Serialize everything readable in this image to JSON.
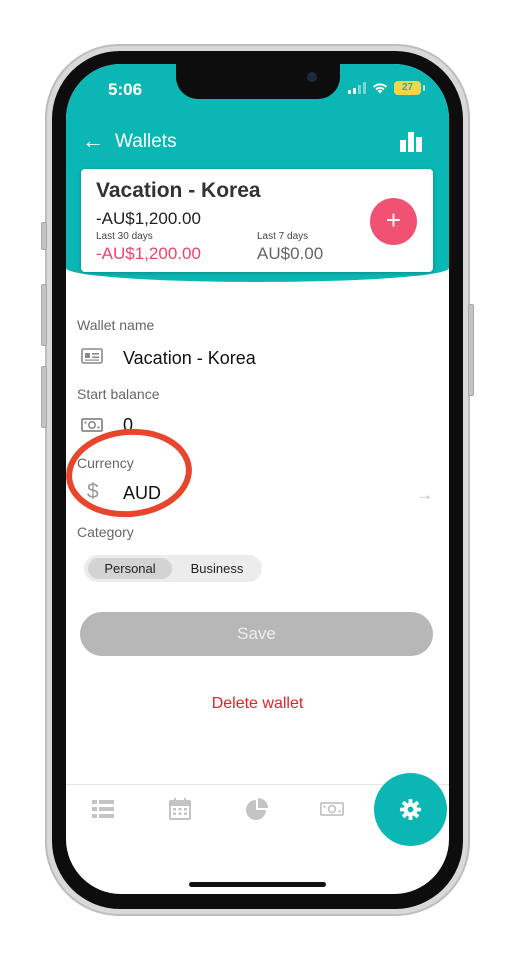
{
  "status_bar": {
    "time": "5:06",
    "battery": "27"
  },
  "header": {
    "title": "Wallets"
  },
  "wallet_card": {
    "name": "Vacation - Korea",
    "balance": "-AU$1,200.00",
    "last30_label": "Last 30 days",
    "last30_value": "-AU$1,200.00",
    "last7_label": "Last 7 days",
    "last7_value": "AU$0.00",
    "add_label": "+"
  },
  "form": {
    "wallet_name_label": "Wallet name",
    "wallet_name_value": "Vacation - Korea",
    "start_balance_label": "Start balance",
    "start_balance_value": "0",
    "currency_label": "Currency",
    "currency_symbol": "$",
    "currency_value": "AUD",
    "currency_arrow": "→",
    "category_label": "Category",
    "category_options": [
      "Personal",
      "Business"
    ],
    "category_selected": "Personal"
  },
  "actions": {
    "save_label": "Save",
    "delete_label": "Delete wallet"
  },
  "bottom_nav": {
    "items": [
      "list-icon",
      "calendar-icon",
      "pie-chart-icon",
      "banknote-icon",
      "gear-icon"
    ],
    "active": "gear-icon"
  },
  "colors": {
    "brand_teal": "#0bb7b4",
    "add_button": "#f25272",
    "negative_value": "#ee4466",
    "delete_red": "#e8202a",
    "annotation_red": "#e8462c"
  }
}
